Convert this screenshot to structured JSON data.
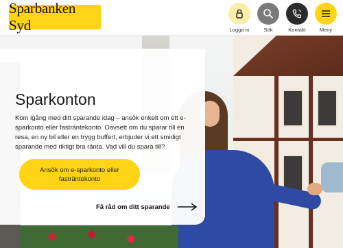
{
  "brand": {
    "logo_text": "Sparbanken Syd"
  },
  "header": {
    "nav": [
      {
        "label": "Logga in",
        "icon": "lock-icon",
        "color": "#fbedaa"
      },
      {
        "label": "Sök",
        "icon": "search-icon",
        "color": "#7a7a7a"
      },
      {
        "label": "Kontakt",
        "icon": "phone-icon",
        "color": "#2b2b2b"
      },
      {
        "label": "Meny",
        "icon": "menu-icon",
        "color": "#ffd415"
      }
    ]
  },
  "hero": {
    "title": "Sparkonton",
    "body": "Kom igång med ditt sparande idag – ansök enkelt om ett e-sparkonto eller fasträntekonto. Oavsett om du sparar till en resa, en ny bil eller en trygg buffert, erbjuder vi ett smidigt sparande med riktigt bra ränta. Vad vill du spara till?",
    "cta_label": "Ansök om e-sparkonto eller fasträntekonto",
    "advice_link": "Få råd om ditt sparande"
  },
  "colors": {
    "accent": "#ffd415",
    "text": "#1a1a1a"
  }
}
